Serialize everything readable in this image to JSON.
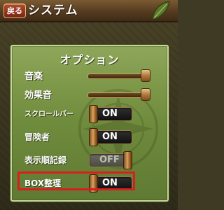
{
  "header": {
    "back_label": "戻る",
    "title": "システム"
  },
  "panel": {
    "title": "オプション",
    "rows": [
      {
        "label": "音楽",
        "type": "slider",
        "level": 1.0
      },
      {
        "label": "効果音",
        "type": "slider",
        "level": 1.0
      },
      {
        "label": "スクロールバー",
        "type": "toggle",
        "state": "ON"
      },
      {
        "label": "冒険者",
        "type": "toggle",
        "state": "ON"
      },
      {
        "label": "表示順記録",
        "type": "toggle",
        "state": "OFF"
      },
      {
        "label": "BOX整理",
        "type": "toggle",
        "state": "ON",
        "highlighted": true
      }
    ]
  },
  "colors": {
    "panel_green": "#6f8b3c",
    "header_brown": "#553c20",
    "highlight_red": "#d81e1e"
  }
}
